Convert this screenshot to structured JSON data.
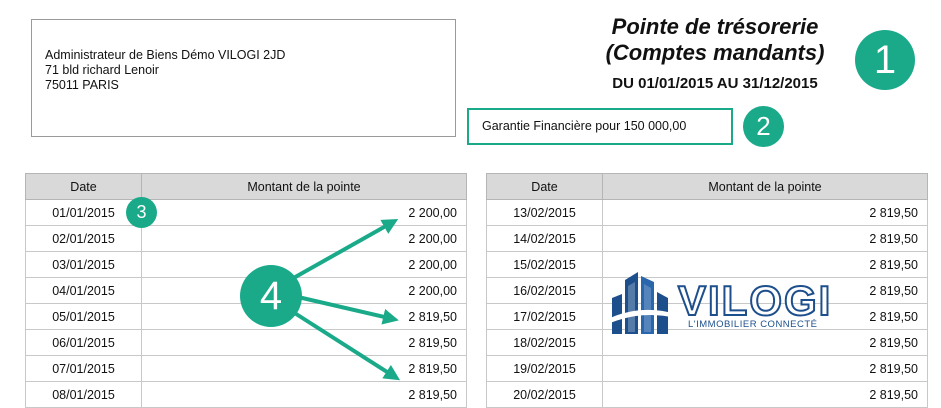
{
  "address": {
    "line1": "Administrateur de Biens Démo VILOGI 2JD",
    "line2": "71 bld richard Lenoir",
    "line3": "75011 PARIS"
  },
  "title": {
    "line1": "Pointe de trésorerie",
    "line2": "(Comptes mandants)",
    "period": "DU 01/01/2015 AU 31/12/2015"
  },
  "guarantee": "Garantie Financière pour 150 000,00",
  "badges": {
    "b1": "1",
    "b2": "2",
    "b3": "3",
    "b4": "4"
  },
  "table_headers": {
    "date": "Date",
    "amount": "Montant de la pointe"
  },
  "table_left": [
    {
      "date": "01/01/2015",
      "amount": "2 200,00"
    },
    {
      "date": "02/01/2015",
      "amount": "2 200,00"
    },
    {
      "date": "03/01/2015",
      "amount": "2 200,00"
    },
    {
      "date": "04/01/2015",
      "amount": "2 200,00"
    },
    {
      "date": "05/01/2015",
      "amount": "2 819,50"
    },
    {
      "date": "06/01/2015",
      "amount": "2 819,50"
    },
    {
      "date": "07/01/2015",
      "amount": "2 819,50"
    },
    {
      "date": "08/01/2015",
      "amount": "2 819,50"
    }
  ],
  "table_right": [
    {
      "date": "13/02/2015",
      "amount": "2 819,50"
    },
    {
      "date": "14/02/2015",
      "amount": "2 819,50"
    },
    {
      "date": "15/02/2015",
      "amount": "2 819,50"
    },
    {
      "date": "16/02/2015",
      "amount": "2 819,50"
    },
    {
      "date": "17/02/2015",
      "amount": "2 819,50"
    },
    {
      "date": "18/02/2015",
      "amount": "2 819,50"
    },
    {
      "date": "19/02/2015",
      "amount": "2 819,50"
    },
    {
      "date": "20/02/2015",
      "amount": "2 819,50"
    }
  ],
  "logo": {
    "word": "VILOGI",
    "tagline": "L'IMMOBILIER CONNECTÉ",
    "icon": "building-icon"
  },
  "colors": {
    "accent": "#1aaa8a",
    "logo_blue": "#1d4f8c",
    "header_gray": "#d9d9d9"
  }
}
